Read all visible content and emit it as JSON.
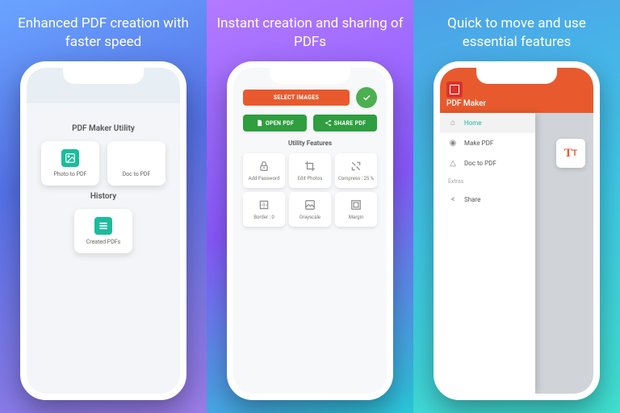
{
  "panels": [
    {
      "headline": "Enhanced PDF creation with faster speed"
    },
    {
      "headline": "Instant creation and sharing of PDFs"
    },
    {
      "headline": "Quick to move and use essential features"
    }
  ],
  "p1": {
    "section1_title": "PDF Maker Utility",
    "photo_label": "Photo to PDF",
    "doc_label": "Doc to PDF",
    "section2_title": "History",
    "history_label": "Created PDFs"
  },
  "p2": {
    "select_images": "SELECT IMAGES",
    "open_pdf": "OPEN PDF",
    "share_pdf": "SHARE PDF",
    "uf_title": "Utility Features",
    "tiles": [
      {
        "label": "Add Password"
      },
      {
        "label": "Edit Photos"
      },
      {
        "label": "Compress : 25 %"
      },
      {
        "label": "Border : 0"
      },
      {
        "label": "Grayscale"
      },
      {
        "label": "Margin"
      }
    ]
  },
  "p3": {
    "app_title": "PDF Maker",
    "nav": {
      "home": "Home",
      "make": "Make PDF",
      "doc": "Doc to PDF",
      "extras": "Extras",
      "share": "Share"
    }
  }
}
